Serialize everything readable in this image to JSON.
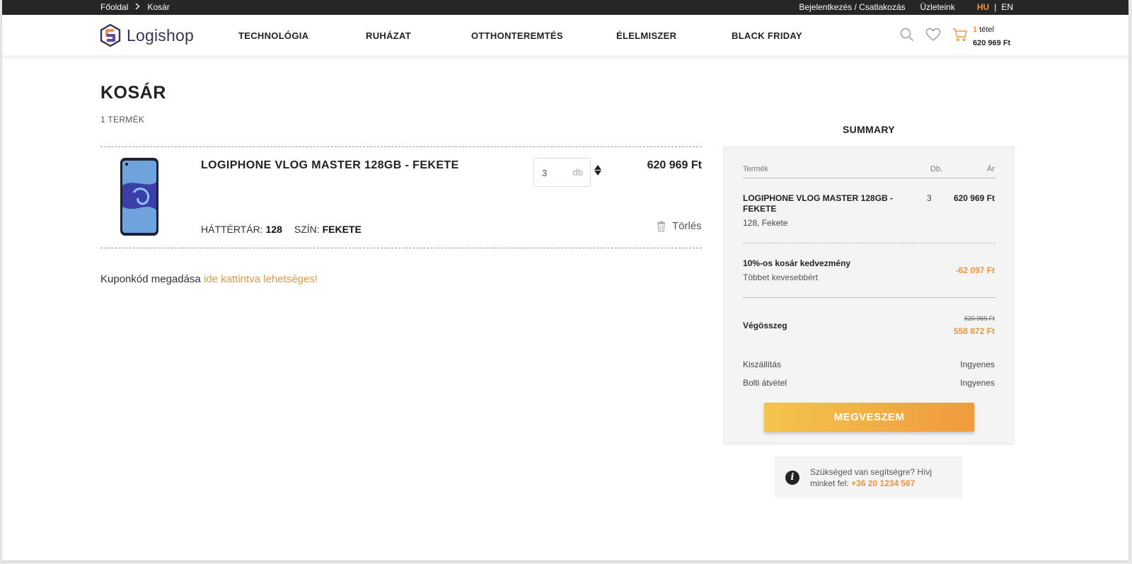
{
  "topbar": {
    "breadcrumb": [
      "Főoldal",
      "Kosár"
    ],
    "login": "Bejelentkezés / Csatlakozás",
    "stores": "Üzleteink",
    "lang_hu": "HU",
    "lang_sep": "|",
    "lang_en": "EN"
  },
  "header": {
    "logo_text": "Logishop",
    "nav": [
      "TECHNOLÓGIA",
      "RUHÁZAT",
      "OTTHONTEREMTÉS",
      "ÉLELMISZER",
      "BLACK FRIDAY"
    ],
    "cart_count": "1",
    "cart_count_label": "tétel",
    "cart_total": "620 969 Ft"
  },
  "cart": {
    "title": "KOSÁR",
    "count": "1 TERMÉK",
    "item": {
      "name": "LOGIPHONE VLOG MASTER 128GB - FEKETE",
      "qty": "3",
      "qty_unit": "db",
      "price": "620 969 Ft",
      "attr1_label": "HÁTTÉRTÁR:",
      "attr1_value": "128",
      "attr2_label": "SZÍN:",
      "attr2_value": "FEKETE",
      "delete_label": "Törlés"
    },
    "coupon_text": "Kuponkód megadása",
    "coupon_link": "ide kattintva lehetséges!"
  },
  "summary": {
    "title": "SUMMARY",
    "col_product": "Termék",
    "col_qty": "Db.",
    "col_price": "Ár",
    "product_name": "LOGIPHONE VLOG MASTER 128GB - FEKETE",
    "product_qty": "3",
    "product_price": "620 969 Ft",
    "product_attrs": "128,  Fekete",
    "discount_name": "10%-os kosár kedvezmény",
    "discount_sub": "Többet kevesebbért",
    "discount_value": "-62 097 Ft",
    "total_label": "Végösszeg",
    "total_old": "620 969 Ft",
    "total_new": "558 872 Ft",
    "shipping_label": "Kiszállítás",
    "shipping_value": "Ingyenes",
    "pickup_label": "Bolti átvétel",
    "pickup_value": "Ingyenes",
    "buy_label": "MEGVESZEM"
  },
  "help": {
    "text": "Szükséged van segítségre? Hívj minket fel:",
    "phone": "+36 20 1234 567"
  },
  "colors": {
    "accent": "#f0953b",
    "button_start": "#f3c54c",
    "button_end": "#f09a3e",
    "topbar": "#262626"
  }
}
